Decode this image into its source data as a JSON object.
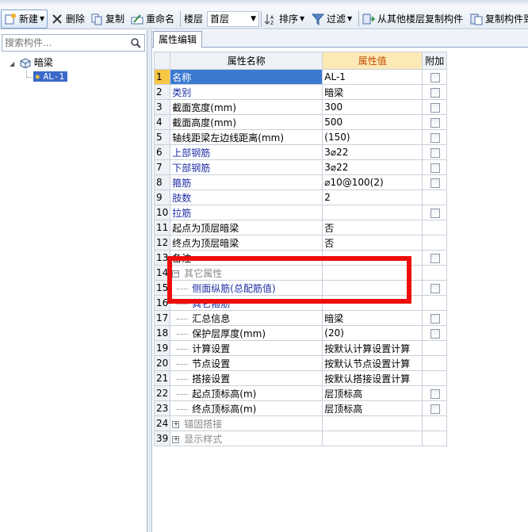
{
  "toolbar": {
    "new_label": "新建",
    "delete_label": "删除",
    "copy_label": "复制",
    "rename_label": "重命名",
    "floor_label": "楼层",
    "floor_value": "首层",
    "sort_label": "排序",
    "filter_label": "过滤",
    "copy_from_floor_label": "从其他楼层复制构件",
    "copy_component_label": "复制构件到"
  },
  "left_panel": {
    "search_placeholder": "搜索构件...",
    "tree": {
      "root_label": "暗梁",
      "child_label": "AL-1"
    }
  },
  "right_panel": {
    "tab_label": "属性编辑",
    "columns": {
      "name": "属性名称",
      "value": "属性值",
      "extra": "附加"
    },
    "rows": [
      {
        "num": "1",
        "name": "名称",
        "value": "AL-1"
      },
      {
        "num": "2",
        "name": "类别",
        "value": "暗梁"
      },
      {
        "num": "3",
        "name": "截面宽度(mm)",
        "value": "300"
      },
      {
        "num": "4",
        "name": "截面高度(mm)",
        "value": "500"
      },
      {
        "num": "5",
        "name": "轴线距梁左边线距离(mm)",
        "value": "(150)"
      },
      {
        "num": "6",
        "name": "上部钢筋",
        "value": "3⌀22"
      },
      {
        "num": "7",
        "name": "下部钢筋",
        "value": "3⌀22"
      },
      {
        "num": "8",
        "name": "箍筋",
        "value": "⌀10@100(2)"
      },
      {
        "num": "9",
        "name": "肢数",
        "value": "2"
      },
      {
        "num": "10",
        "name": "拉筋",
        "value": ""
      },
      {
        "num": "11",
        "name": "起点为顶层暗梁",
        "value": "否"
      },
      {
        "num": "12",
        "name": "终点为顶层暗梁",
        "value": "否"
      },
      {
        "num": "13",
        "name": "备注",
        "value": ""
      },
      {
        "num": "14",
        "name": "其它属性",
        "value": ""
      },
      {
        "num": "15",
        "name": "侧面纵筋(总配筋值)",
        "value": ""
      },
      {
        "num": "16",
        "name": "其它箍筋",
        "value": ""
      },
      {
        "num": "17",
        "name": "汇总信息",
        "value": "暗梁"
      },
      {
        "num": "18",
        "name": "保护层厚度(mm)",
        "value": "(20)"
      },
      {
        "num": "19",
        "name": "计算设置",
        "value": "按默认计算设置计算"
      },
      {
        "num": "20",
        "name": "节点设置",
        "value": "按默认节点设置计算"
      },
      {
        "num": "21",
        "name": "搭接设置",
        "value": "按默认搭接设置计算"
      },
      {
        "num": "22",
        "name": "起点顶标高(m)",
        "value": "层顶标高"
      },
      {
        "num": "23",
        "name": "终点顶标高(m)",
        "value": "层顶标高"
      },
      {
        "num": "24",
        "name": "锚固搭接",
        "value": ""
      },
      {
        "num": "39",
        "name": "显示样式",
        "value": ""
      }
    ],
    "expander_collapse": "−",
    "expander_expand": "+"
  },
  "colors": {
    "highlight_box": "#ee0d0d",
    "selected_row": "#3b7ad1",
    "value_header": "#fbe9b6"
  }
}
